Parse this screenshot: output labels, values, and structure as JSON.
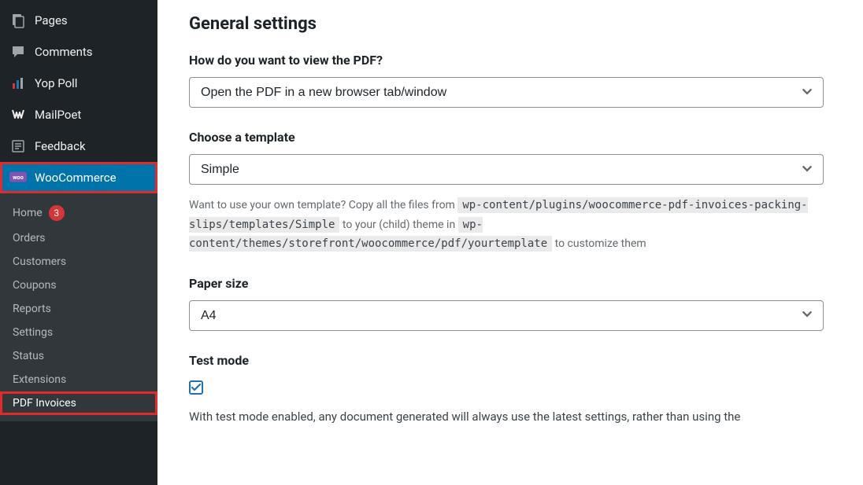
{
  "sidebar": {
    "top": [
      {
        "name": "pages",
        "label": "Pages"
      },
      {
        "name": "comments",
        "label": "Comments"
      },
      {
        "name": "yoppoll",
        "label": "Yop Poll"
      },
      {
        "name": "mailpoet",
        "label": "MailPoet"
      },
      {
        "name": "feedback",
        "label": "Feedback"
      }
    ],
    "woocommerce_label": "WooCommerce",
    "sub": [
      {
        "name": "home",
        "label": "Home",
        "badge": "3"
      },
      {
        "name": "orders",
        "label": "Orders"
      },
      {
        "name": "customers",
        "label": "Customers"
      },
      {
        "name": "coupons",
        "label": "Coupons"
      },
      {
        "name": "reports",
        "label": "Reports"
      },
      {
        "name": "settings",
        "label": "Settings"
      },
      {
        "name": "status",
        "label": "Status"
      },
      {
        "name": "extensions",
        "label": "Extensions"
      },
      {
        "name": "pdfinvoices",
        "label": "PDF Invoices"
      }
    ]
  },
  "main": {
    "section_title": "General settings",
    "view_pdf": {
      "label": "How do you want to view the PDF?",
      "value": "Open the PDF in a new browser tab/window"
    },
    "template": {
      "label": "Choose a template",
      "value": "Simple",
      "help_pre": "Want to use your own template? Copy all the files from ",
      "path1": "wp-content/plugins/woocommerce-pdf-invoices-packing-slips/templates/Simple",
      "help_mid": " to your (child) theme in ",
      "path2": "wp-content/themes/storefront/woocommerce/pdf/yourtemplate",
      "help_post": " to customize them"
    },
    "paper": {
      "label": "Paper size",
      "value": "A4"
    },
    "testmode": {
      "label": "Test mode",
      "checked": true,
      "desc": "With test mode enabled, any document generated will always use the latest settings, rather than using the"
    }
  }
}
